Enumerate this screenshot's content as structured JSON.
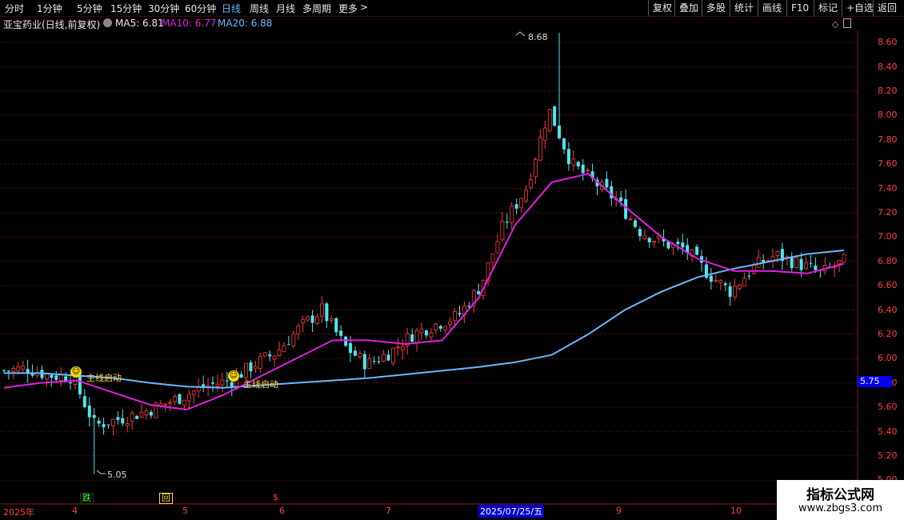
{
  "periods": [
    {
      "label": "分时",
      "active": false
    },
    {
      "label": "1分钟",
      "active": false
    },
    {
      "label": "5分钟",
      "active": false
    },
    {
      "label": "15分钟",
      "active": false
    },
    {
      "label": "30分钟",
      "active": false
    },
    {
      "label": "60分钟",
      "active": false
    },
    {
      "label": "日线",
      "active": true
    },
    {
      "label": "周线",
      "active": false
    },
    {
      "label": "月线",
      "active": false
    },
    {
      "label": "多周期",
      "active": false
    },
    {
      "label": "更多",
      "active": false
    }
  ],
  "more_arrow": ">",
  "tools": [
    "复权",
    "叠加",
    "多股",
    "统计",
    "画线",
    "F10",
    "标记",
    "+自选",
    "返回"
  ],
  "stock_title": "亚宝药业(日线,前复权)",
  "ma": {
    "ma5": "MA5: 6.81",
    "ma10": "MA10: 6.77",
    "ma20": "MA20: 6.88"
  },
  "colors": {
    "up": "#ff3b3b",
    "down": "#4ee6f0",
    "ma5": "#ffffff",
    "ma10": "#e020e0",
    "ma20": "#6ab8ff",
    "grid": "#7a1010"
  },
  "y_axis_labels": [
    "8.60",
    "8.40",
    "8.20",
    "8.00",
    "7.80",
    "7.60",
    "7.40",
    "7.20",
    "7.00",
    "6.80",
    "6.60",
    "6.40",
    "6.20",
    "6.00",
    "5.80",
    "5.60",
    "5.40",
    "5.20",
    "5.00"
  ],
  "current_price_box": "5.75",
  "high_label": "8.68",
  "low_label": "5.05",
  "signals": [
    "主线启动",
    "主线启动"
  ],
  "markers": {
    "fall": "跌",
    "back": "回",
    "sign": "$"
  },
  "dates": {
    "year": "2025年",
    "m4": "4",
    "m5": "5",
    "m6": "6",
    "m7": "7",
    "highlight": "2025/07/25/五",
    "m9": "9",
    "m10": "10"
  },
  "watermark": {
    "title": "指标公式网",
    "url": "www.zbgs3.com"
  },
  "chart_data": {
    "type": "candlestick",
    "price_range": [
      5.0,
      8.7
    ],
    "y_ticks": [
      8.6,
      8.4,
      8.2,
      8.0,
      7.8,
      7.6,
      7.4,
      7.2,
      7.0,
      6.8,
      6.6,
      6.4,
      6.2,
      6.0,
      5.8,
      5.6,
      5.4,
      5.2,
      5.0
    ],
    "high": 8.68,
    "low": 5.05,
    "ma_series": [
      {
        "name": "MA20",
        "color": "#6ab8ff",
        "values": [
          5.88,
          5.88,
          5.86,
          5.84,
          5.8,
          5.77,
          5.76,
          5.78,
          5.8,
          5.82,
          5.84,
          5.87,
          5.9,
          5.93,
          5.97,
          6.03,
          6.2,
          6.4,
          6.55,
          6.67,
          6.74,
          6.8,
          6.86,
          6.89
        ]
      },
      {
        "name": "MA10",
        "color": "#e020e0",
        "values": [
          5.76,
          5.8,
          5.82,
          5.72,
          5.62,
          5.58,
          5.7,
          5.85,
          6.0,
          6.15,
          6.15,
          6.12,
          6.15,
          6.5,
          7.1,
          7.45,
          7.52,
          7.25,
          7.0,
          6.82,
          6.72,
          6.72,
          6.7,
          6.78
        ]
      }
    ]
  }
}
